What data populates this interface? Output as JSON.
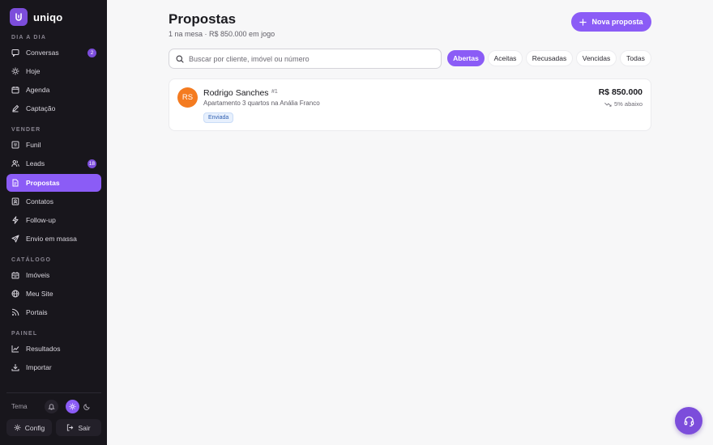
{
  "app": {
    "name": "uniqo"
  },
  "colors": {
    "accent": "#8b5cf6",
    "sidebar_bg": "#18161c",
    "avatar": "#f47b20"
  },
  "sidebar": {
    "sections": {
      "dia_a_dia": "DIA A DIA",
      "vender": "VENDER",
      "catalogo": "CATÁLOGO",
      "painel": "PAINEL"
    },
    "items": [
      {
        "label": "Conversas",
        "icon": "chat-icon",
        "badge": "2"
      },
      {
        "label": "Hoje",
        "icon": "sun-icon"
      },
      {
        "label": "Agenda",
        "icon": "calendar-icon"
      },
      {
        "label": "Captação",
        "icon": "pen-icon"
      },
      {
        "label": "Funil",
        "icon": "funnel-icon"
      },
      {
        "label": "Leads",
        "icon": "users-icon",
        "badge": "18"
      },
      {
        "label": "Propostas",
        "icon": "document-icon",
        "active": true
      },
      {
        "label": "Contatos",
        "icon": "contact-icon"
      },
      {
        "label": "Follow-up",
        "icon": "bolt-icon"
      },
      {
        "label": "Envio em massa",
        "icon": "send-icon"
      },
      {
        "label": "Imóveis",
        "icon": "building-icon"
      },
      {
        "label": "Meu Site",
        "icon": "globe-icon"
      },
      {
        "label": "Portais",
        "icon": "rss-icon"
      },
      {
        "label": "Resultados",
        "icon": "chart-icon"
      },
      {
        "label": "Importar",
        "icon": "download-icon"
      }
    ],
    "footer": {
      "theme_label": "Tema",
      "config_label": "Config",
      "logout_label": "Sair"
    }
  },
  "main": {
    "title": "Propostas",
    "subtitle": "1 na mesa · R$ 850.000 em jogo",
    "new_button": "Nova proposta",
    "search_placeholder": "Buscar por cliente, imóvel ou número",
    "filters": [
      {
        "label": "Abertas",
        "active": true
      },
      {
        "label": "Aceitas"
      },
      {
        "label": "Recusadas"
      },
      {
        "label": "Vencidas"
      },
      {
        "label": "Todas"
      }
    ],
    "proposals": [
      {
        "initials": "RS",
        "customer": "Rodrigo Sanches",
        "number": "#1",
        "property": "Apartamento 3 quartos na Anália Franco",
        "status": "Enviada",
        "amount": "R$ 850.000",
        "delta": "5% abaixo"
      }
    ]
  }
}
